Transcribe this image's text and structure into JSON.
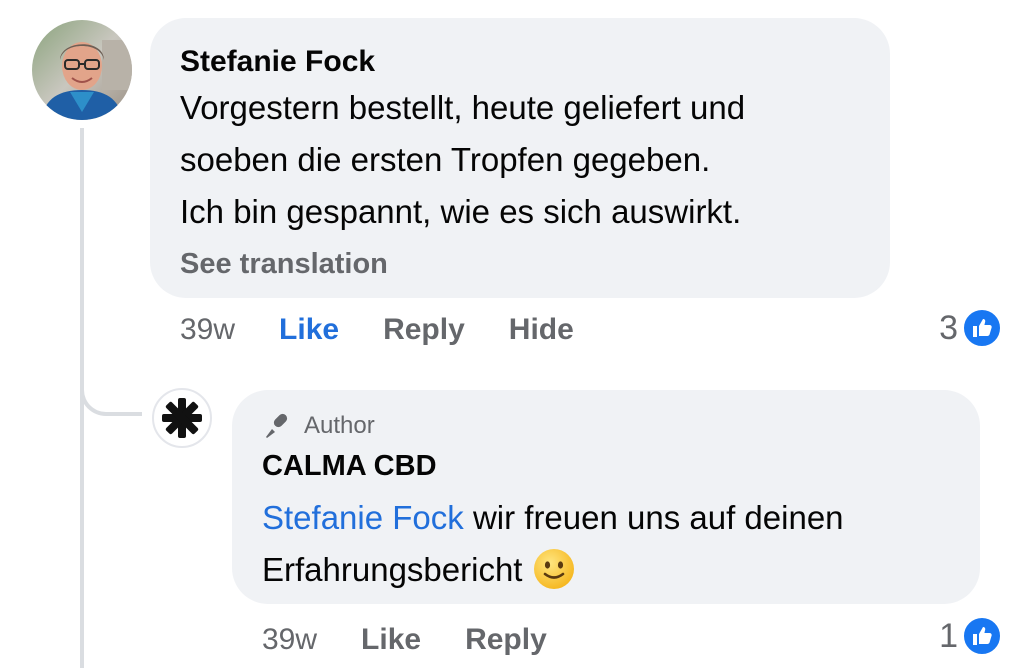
{
  "main_comment": {
    "author": "Stefanie Fock",
    "text_lines": [
      "Vorgestern bestellt, heute geliefert und",
      "soeben die ersten Tropfen gegeben.",
      "Ich bin gespannt, wie es sich auswirkt."
    ],
    "see_translation": "See translation",
    "time": "39w",
    "like_label": "Like",
    "reply_label": "Reply",
    "hide_label": "Hide",
    "reaction_count": "3"
  },
  "reply_comment": {
    "badge": "Author",
    "author": "CALMA CBD",
    "mention": "Stefanie Fock",
    "text_line1_rest": " wir freuen uns auf deinen",
    "text_line2": "Erfahrungsbericht",
    "emoji": "slightly-smiling-face-icon",
    "time": "39w",
    "like_label": "Like",
    "reply_label": "Reply",
    "reaction_count": "1"
  },
  "colors": {
    "bubble": "#f0f2f5",
    "link_blue": "#216fdb",
    "secondary_text": "#65676b",
    "like_blue": "#1877f2"
  },
  "icons": {
    "author_badge": "microphone-pen-icon",
    "reaction": "thumbs-up-icon",
    "reply_avatar": "asterisk-logo-icon"
  }
}
